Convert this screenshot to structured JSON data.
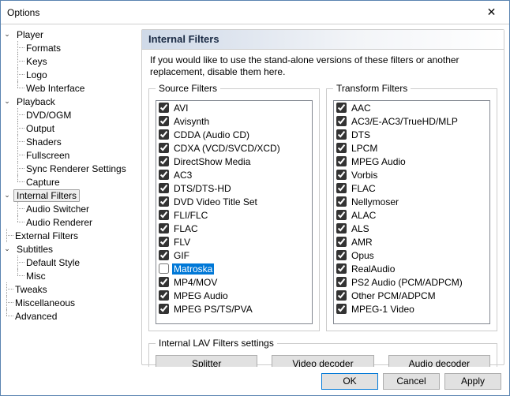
{
  "window": {
    "title": "Options"
  },
  "tree": [
    {
      "label": "Player",
      "expanded": true,
      "children": [
        {
          "label": "Formats"
        },
        {
          "label": "Keys"
        },
        {
          "label": "Logo"
        },
        {
          "label": "Web Interface"
        }
      ]
    },
    {
      "label": "Playback",
      "expanded": true,
      "children": [
        {
          "label": "DVD/OGM"
        },
        {
          "label": "Output"
        },
        {
          "label": "Shaders"
        },
        {
          "label": "Fullscreen"
        },
        {
          "label": "Sync Renderer Settings"
        },
        {
          "label": "Capture"
        }
      ]
    },
    {
      "label": "Internal Filters",
      "expanded": true,
      "selected": true,
      "children": [
        {
          "label": "Audio Switcher"
        },
        {
          "label": "Audio Renderer"
        }
      ]
    },
    {
      "label": "External Filters"
    },
    {
      "label": "Subtitles",
      "expanded": true,
      "children": [
        {
          "label": "Default Style"
        },
        {
          "label": "Misc"
        }
      ]
    },
    {
      "label": "Tweaks"
    },
    {
      "label": "Miscellaneous"
    },
    {
      "label": "Advanced"
    }
  ],
  "page": {
    "title": "Internal Filters",
    "intro": "If you would like to use the stand-alone versions of these filters or another replacement, disable them here.",
    "source": {
      "legend": "Source Filters",
      "items": [
        {
          "label": "AVI",
          "checked": true
        },
        {
          "label": "Avisynth",
          "checked": true
        },
        {
          "label": "CDDA (Audio CD)",
          "checked": true
        },
        {
          "label": "CDXA (VCD/SVCD/XCD)",
          "checked": true
        },
        {
          "label": "DirectShow Media",
          "checked": true
        },
        {
          "label": "AC3",
          "checked": true
        },
        {
          "label": "DTS/DTS-HD",
          "checked": true
        },
        {
          "label": "DVD Video Title Set",
          "checked": true
        },
        {
          "label": "FLI/FLC",
          "checked": true
        },
        {
          "label": "FLAC",
          "checked": true
        },
        {
          "label": "FLV",
          "checked": true
        },
        {
          "label": "GIF",
          "checked": true
        },
        {
          "label": "Matroska",
          "checked": false,
          "selected": true
        },
        {
          "label": "MP4/MOV",
          "checked": true
        },
        {
          "label": "MPEG Audio",
          "checked": true
        },
        {
          "label": "MPEG PS/TS/PVA",
          "checked": true
        }
      ]
    },
    "transform": {
      "legend": "Transform Filters",
      "items": [
        {
          "label": "AAC",
          "checked": true
        },
        {
          "label": "AC3/E-AC3/TrueHD/MLP",
          "checked": true
        },
        {
          "label": "DTS",
          "checked": true
        },
        {
          "label": "LPCM",
          "checked": true
        },
        {
          "label": "MPEG Audio",
          "checked": true
        },
        {
          "label": "Vorbis",
          "checked": true
        },
        {
          "label": "FLAC",
          "checked": true
        },
        {
          "label": "Nellymoser",
          "checked": true
        },
        {
          "label": "ALAC",
          "checked": true
        },
        {
          "label": "ALS",
          "checked": true
        },
        {
          "label": "AMR",
          "checked": true
        },
        {
          "label": "Opus",
          "checked": true
        },
        {
          "label": "RealAudio",
          "checked": true
        },
        {
          "label": "PS2 Audio (PCM/ADPCM)",
          "checked": true
        },
        {
          "label": "Other PCM/ADPCM",
          "checked": true
        },
        {
          "label": "MPEG-1 Video",
          "checked": true
        }
      ]
    },
    "lav": {
      "legend": "Internal LAV Filters settings",
      "splitter": "Splitter",
      "video": "Video decoder",
      "audio": "Audio decoder"
    }
  },
  "footer": {
    "ok": "OK",
    "cancel": "Cancel",
    "apply": "Apply"
  }
}
